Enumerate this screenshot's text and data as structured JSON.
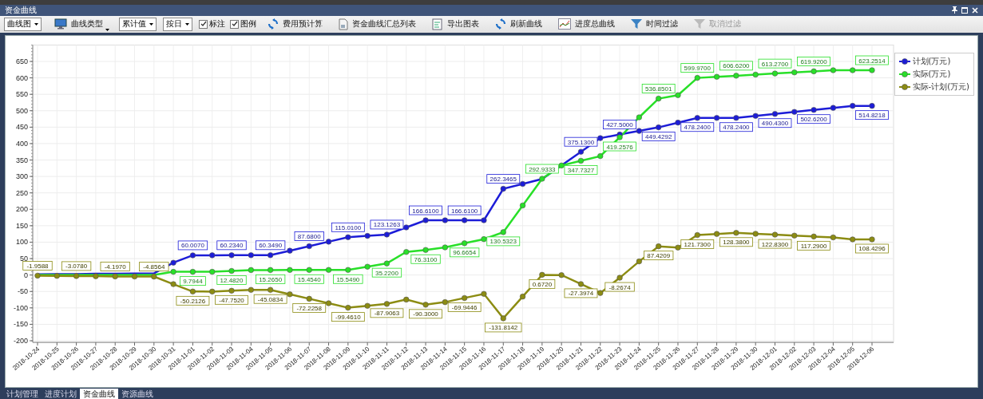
{
  "window": {
    "title": "资金曲线"
  },
  "toolbar": [
    {
      "kind": "dropdown",
      "label": "曲线图"
    },
    {
      "kind": "menubutton",
      "label": "曲线类型"
    },
    {
      "kind": "dropdown",
      "label": "累计值"
    },
    {
      "kind": "dropdown",
      "label": "按日"
    },
    {
      "kind": "checkbox",
      "label": "标注",
      "checked": true
    },
    {
      "kind": "checkbox",
      "label": "图例",
      "checked": true
    },
    {
      "kind": "button",
      "label": "费用预计算",
      "disabled": false
    },
    {
      "kind": "button",
      "label": "资金曲线汇总列表",
      "disabled": false
    },
    {
      "kind": "button",
      "label": "导出图表",
      "disabled": false
    },
    {
      "kind": "button",
      "label": "刷新曲线",
      "disabled": false
    },
    {
      "kind": "button",
      "label": "进度总曲线",
      "disabled": false
    },
    {
      "kind": "button",
      "label": "时间过滤",
      "disabled": false
    },
    {
      "kind": "button",
      "label": "取消过滤",
      "disabled": true
    }
  ],
  "chart": {
    "chart_data": {
      "type": "line",
      "grid": true,
      "categories": [
        "2018-10-24",
        "2018-10-25",
        "2018-10-26",
        "2018-10-27",
        "2018-10-28",
        "2018-10-29",
        "2018-10-30",
        "2018-10-31",
        "2018-11-01",
        "2018-11-02",
        "2018-11-03",
        "2018-11-04",
        "2018-11-05",
        "2018-11-06",
        "2018-11-07",
        "2018-11-08",
        "2018-11-09",
        "2018-11-10",
        "2018-11-11",
        "2018-11-12",
        "2018-11-13",
        "2018-11-14",
        "2018-11-15",
        "2018-11-16",
        "2018-11-17",
        "2018-11-18",
        "2018-11-19",
        "2018-11-20",
        "2018-11-21",
        "2018-11-22",
        "2018-11-23",
        "2018-11-24",
        "2018-11-25",
        "2018-11-26",
        "2018-11-27",
        "2018-11-28",
        "2018-11-29",
        "2018-11-30",
        "2018-12-01",
        "2018-12-02",
        "2018-12-03",
        "2018-12-04",
        "2018-12-05",
        "2018-12-06"
      ],
      "ylim": [
        -205,
        700
      ],
      "yticks": [
        -200,
        -150,
        -100,
        -50,
        0,
        50,
        100,
        150,
        200,
        250,
        300,
        350,
        400,
        450,
        500,
        550,
        600,
        650
      ],
      "series": [
        {
          "name": "计划(万元)",
          "color": "#1c1cd8",
          "marker": "circle",
          "values": [
            1.9588,
            2.518,
            3.078,
            3.637,
            4.197,
            4.526,
            4.8564,
            37.4941,
            60.007,
            60.121,
            60.234,
            60.348,
            60.349,
            74.01,
            87.68,
            101.39,
            115.01,
            119.06,
            123.1263,
            144.9172,
            166.61,
            166.61,
            166.61,
            166.6144,
            262.3465,
            277.3039,
            292.2613,
            333.5,
            375.13,
            416.57,
            427.5,
            438.47,
            449.4292,
            463.8335,
            478.24,
            478.24,
            478.24,
            484.34,
            490.43,
            496.53,
            502.62,
            508.72,
            514.82,
            514.8218
          ],
          "value_labels": [
            null,
            null,
            null,
            null,
            null,
            null,
            null,
            null,
            "60.0070",
            null,
            "60.2340",
            null,
            "60.3490",
            null,
            "87.6800",
            null,
            "115.0100",
            null,
            "123.1263",
            null,
            "166.6100",
            null,
            "166.6100",
            null,
            "262.3465",
            null,
            null,
            null,
            "375.1300",
            null,
            "427.5000",
            null,
            "449.4292",
            null,
            "478.2400",
            null,
            "478.2400",
            null,
            "490.4300",
            null,
            "502.6200",
            null,
            null,
            "514.8218"
          ]
        },
        {
          "name": "实际(万元)",
          "color": "#28e028",
          "marker": "circle",
          "values": [
            0,
            0,
            0,
            0,
            0,
            0,
            0,
            9.7944,
            9.7944,
            9.7944,
            12.482,
            15.17,
            15.265,
            15.359,
            15.454,
            15.549,
            15.549,
            25.384,
            35.22,
            70.21,
            76.31,
            84.09,
            96.6654,
            109.2403,
            130.5323,
            211.7328,
            292.9333,
            333.3631,
            347.7327,
            361.9155,
            419.2576,
            479.925,
            536.8501,
            547.366,
            599.97,
            603.29,
            606.62,
            609.95,
            613.27,
            616.6,
            619.92,
            623.25,
            623.25,
            623.2514
          ],
          "value_labels": [
            null,
            null,
            null,
            null,
            null,
            null,
            null,
            null,
            "9.7944",
            null,
            "12.4820",
            null,
            "15.2650",
            null,
            "15.4540",
            null,
            "15.5490",
            null,
            "35.2200",
            null,
            "76.3100",
            null,
            "96.6654",
            null,
            "130.5323",
            null,
            "292.9333",
            null,
            "347.7327",
            null,
            "419.2576",
            null,
            "536.8501",
            null,
            "599.9700",
            null,
            "606.6200",
            null,
            "613.2700",
            null,
            "619.9200",
            null,
            null,
            "623.2514"
          ]
        },
        {
          "name": "实际-计划(万元)",
          "color": "#8c8c12",
          "marker": "circle",
          "values": [
            -1.9588,
            -2.518,
            -3.078,
            -3.637,
            -4.197,
            -4.526,
            -4.8564,
            -27.6997,
            -50.2126,
            -50.3266,
            -47.752,
            -45.178,
            -45.0834,
            -58.6511,
            -72.2258,
            -85.8411,
            -99.461,
            -93.676,
            -87.9063,
            -74.7044,
            -90.3,
            -82.52,
            -69.9446,
            -57.3741,
            -131.8142,
            -65.5711,
            0.672,
            -0.1374,
            -27.3974,
            -54.6574,
            -8.2674,
            41.4479,
            87.4209,
            83.5294,
            121.73,
            125.05,
            128.38,
            125.6,
            122.83,
            120.06,
            117.29,
            114.52,
            108.42,
            108.4296
          ],
          "value_labels": [
            "-1.9588",
            null,
            "-3.0780",
            null,
            "-4.1970",
            null,
            "-4.8564",
            null,
            "-50.2126",
            null,
            "-47.7520",
            null,
            "-45.0834",
            null,
            "-72.2258",
            null,
            "-99.4610",
            null,
            "-87.9063",
            null,
            "-90.3000",
            null,
            "-69.9446",
            null,
            "-131.8142",
            null,
            "0.6720",
            null,
            "-27.3974",
            null,
            "-8.2674",
            null,
            "87.4209",
            null,
            "121.7300",
            null,
            "128.3800",
            null,
            "122.8300",
            null,
            "117.2900",
            null,
            null,
            "108.4296"
          ]
        }
      ]
    }
  },
  "bottom_tabs": [
    {
      "label": "计划管理",
      "selected": false
    },
    {
      "label": "进度计划",
      "selected": false
    },
    {
      "label": "资金曲线",
      "selected": true
    },
    {
      "label": "资源曲线",
      "selected": false
    }
  ]
}
